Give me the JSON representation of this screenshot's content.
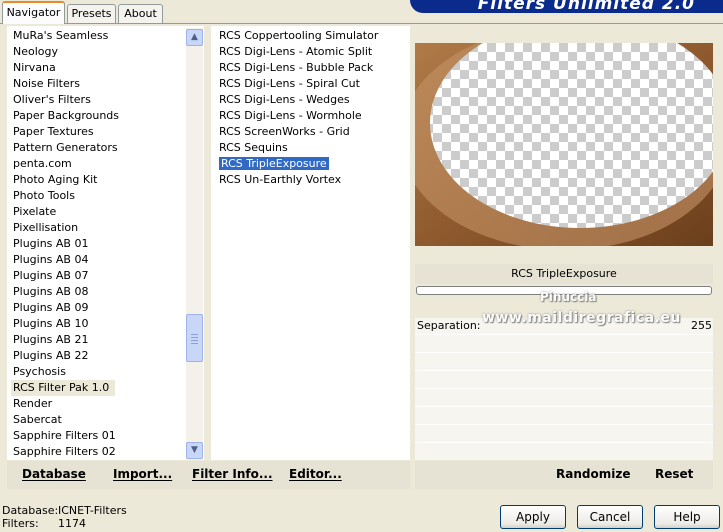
{
  "banner_title": "Filters Unlimited 2.0",
  "tabs": [
    {
      "label": "Navigator",
      "active": true
    },
    {
      "label": "Presets",
      "active": false
    },
    {
      "label": "About",
      "active": false
    }
  ],
  "categories": [
    "MuRa's Seamless",
    "Neology",
    "Nirvana",
    "Noise Filters",
    "Oliver's Filters",
    "Paper Backgrounds",
    "Paper Textures",
    "Pattern Generators",
    "penta.com",
    "Photo Aging Kit",
    "Photo Tools",
    "Pixelate",
    "Pixellisation",
    "Plugins AB 01",
    "Plugins AB 04",
    "Plugins AB 07",
    "Plugins AB 08",
    "Plugins AB 09",
    "Plugins AB 10",
    "Plugins AB 21",
    "Plugins AB 22",
    "Psychosis",
    "RCS Filter Pak 1.0",
    "Render",
    "Sabercat",
    "Sapphire Filters 01",
    "Sapphire Filters 02"
  ],
  "selected_category": "RCS Filter Pak 1.0",
  "filters": [
    "RCS Coppertooling Simulator",
    "RCS Digi-Lens - Atomic Split",
    "RCS Digi-Lens - Bubble Pack",
    "RCS Digi-Lens - Spiral Cut",
    "RCS Digi-Lens - Wedges",
    "RCS Digi-Lens - Wormhole",
    "RCS ScreenWorks - Grid",
    "RCS Sequins",
    "RCS TripleExposure",
    "RCS Un-Earthly Vortex"
  ],
  "selected_filter": "RCS TripleExposure",
  "preview_filter_name": "RCS TripleExposure",
  "parameter": {
    "label": "Separation:",
    "value": "255"
  },
  "watermark": {
    "line1": "Pinuccia",
    "line2": "www.maildiregrafica.eu"
  },
  "left_toolbar": {
    "database": "Database",
    "import": "Import...",
    "filter_info": "Filter Info...",
    "editor": "Editor..."
  },
  "right_toolbar": {
    "randomize": "Randomize",
    "reset": "Reset"
  },
  "status": {
    "database_label": "Database:",
    "database_value": "ICNET-Filters",
    "filters_label": "Filters:",
    "filters_value": "1174"
  },
  "buttons": {
    "apply": "Apply",
    "cancel": "Cancel",
    "help": "Help"
  },
  "colors": {
    "selection": "#316ac5",
    "dialog_bg": "#ece9d8",
    "banner": "#0a2b8c",
    "preview_brown": "#8f5a2e"
  }
}
